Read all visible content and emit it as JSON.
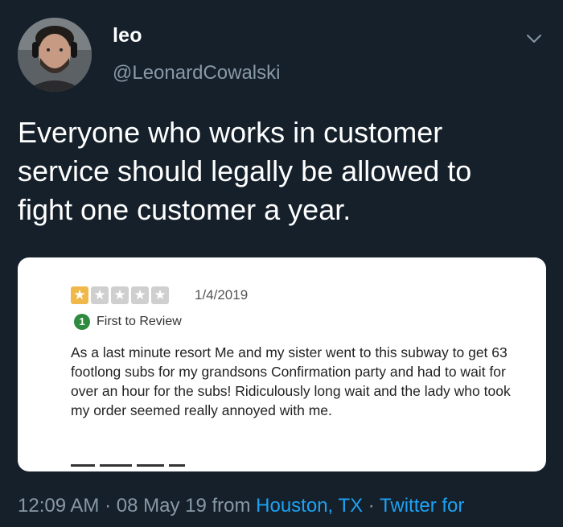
{
  "user": {
    "display_name": "leo",
    "handle": "@LeonardCowalski"
  },
  "tweet": {
    "text": "Everyone who works in customer service should legally be allowed to fight one customer a year."
  },
  "review": {
    "rating": 1,
    "max_rating": 5,
    "date": "1/4/2019",
    "badge_number": "1",
    "badge_label": "First to Review",
    "body": "As a last minute resort Me and my sister went to this subway to get 63 footlong subs for my grandsons Confirmation party and had to wait for over an hour for the subs! Ridiculously long wait and the lady who took my order seemed really annoyed with me.",
    "colors": {
      "star_filled": "#f0b84a",
      "star_empty": "#cfcfcf",
      "badge": "#2d8a3e"
    }
  },
  "footer": {
    "time": "12:09 AM",
    "separator1": " · ",
    "date": "08 May 19",
    "from_label": " from ",
    "location": "Houston, TX",
    "separator2": " · ",
    "source": "Twitter for"
  },
  "colors": {
    "background": "#15202b",
    "link": "#1da1f2",
    "secondary_text": "#8899a6"
  },
  "icons": {
    "menu": "chevron-down-icon",
    "star": "star-icon",
    "badge": "first-review-badge-icon"
  }
}
